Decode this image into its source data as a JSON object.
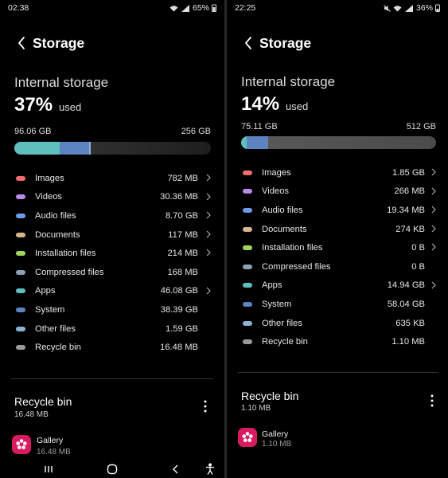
{
  "left": {
    "status": {
      "time": "02:38",
      "battery": "65%"
    },
    "header": {
      "title": "Storage"
    },
    "internal": {
      "title": "Internal storage",
      "percent": "37%",
      "used_label": "used",
      "used": "96.06 GB",
      "total": "256 GB"
    },
    "bar_segments": [
      {
        "color": "#5fbfbd",
        "fraction": 0.23
      },
      {
        "color": "#5b84c0",
        "fraction": 0.15
      },
      {
        "color": "#8bb2d4",
        "fraction": 0.01
      }
    ],
    "categories": [
      {
        "label": "Images",
        "size": "782 MB",
        "color": "#f06d72",
        "chevron": true
      },
      {
        "label": "Videos",
        "size": "30.36 MB",
        "color": "#b48ce6",
        "chevron": true
      },
      {
        "label": "Audio files",
        "size": "8.70 GB",
        "color": "#6f9ae8",
        "chevron": true
      },
      {
        "label": "Documents",
        "size": "117 MB",
        "color": "#d6b48c",
        "chevron": true
      },
      {
        "label": "Installation files",
        "size": "214 MB",
        "color": "#a4d65e",
        "chevron": true
      },
      {
        "label": "Compressed files",
        "size": "168 MB",
        "color": "#8fa0b5",
        "chevron": false
      },
      {
        "label": "Apps",
        "size": "46.08 GB",
        "color": "#5fbfbd",
        "chevron": true
      },
      {
        "label": "System",
        "size": "38.39 GB",
        "color": "#5b84c0",
        "chevron": false
      },
      {
        "label": "Other files",
        "size": "1.59 GB",
        "color": "#8bb2d4",
        "chevron": false
      },
      {
        "label": "Recycle bin",
        "size": "16.48 MB",
        "color": "#9a9a9a",
        "chevron": false
      }
    ],
    "recycle": {
      "title": "Recycle bin",
      "size": "16.48 MB"
    },
    "gallery": {
      "name": "Gallery",
      "size": "16.48 MB"
    }
  },
  "right": {
    "status": {
      "time": "22:25",
      "battery": "36%"
    },
    "header": {
      "title": "Storage"
    },
    "internal": {
      "title": "Internal storage",
      "percent": "14%",
      "used_label": "used",
      "used": "75.11 GB",
      "total": "512 GB"
    },
    "bar_segments": [
      {
        "color": "#5fbfbd",
        "fraction": 0.03
      },
      {
        "color": "#5b84c0",
        "fraction": 0.11
      }
    ],
    "categories": [
      {
        "label": "Images",
        "size": "1.85 GB",
        "color": "#f06d72",
        "chevron": true
      },
      {
        "label": "Videos",
        "size": "266 MB",
        "color": "#b48ce6",
        "chevron": true
      },
      {
        "label": "Audio files",
        "size": "19.34 MB",
        "color": "#6f9ae8",
        "chevron": true
      },
      {
        "label": "Documents",
        "size": "274 KB",
        "color": "#d6b48c",
        "chevron": true
      },
      {
        "label": "Installation files",
        "size": "0 B",
        "color": "#a4d65e",
        "chevron": true
      },
      {
        "label": "Compressed files",
        "size": "0 B",
        "color": "#8fa0b5",
        "chevron": false
      },
      {
        "label": "Apps",
        "size": "14.94 GB",
        "color": "#5fbfbd",
        "chevron": true
      },
      {
        "label": "System",
        "size": "58.04 GB",
        "color": "#5b84c0",
        "chevron": false
      },
      {
        "label": "Other files",
        "size": "635 KB",
        "color": "#8bb2d4",
        "chevron": false
      },
      {
        "label": "Recycle bin",
        "size": "1.10 MB",
        "color": "#9a9a9a",
        "chevron": false
      }
    ],
    "recycle": {
      "title": "Recycle bin",
      "size": "1.10 MB"
    },
    "gallery": {
      "name": "Gallery",
      "size": "1.10 MB"
    }
  }
}
